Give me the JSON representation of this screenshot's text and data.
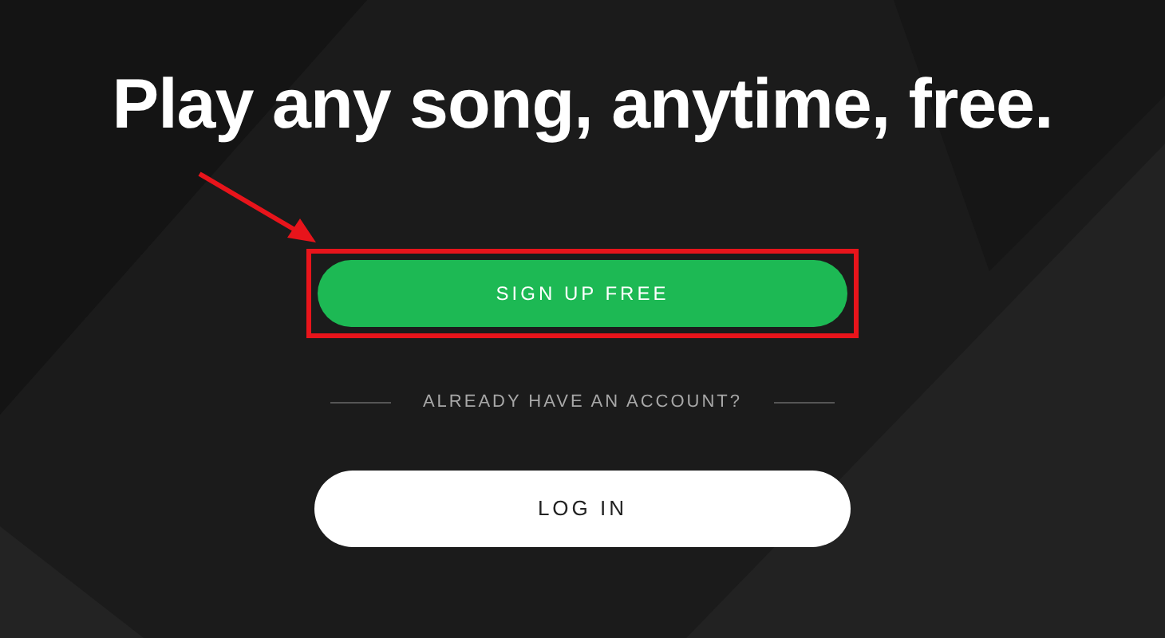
{
  "heading": "Play any song, anytime, free.",
  "signup_button": {
    "label": "SIGN UP FREE"
  },
  "divider_text": "ALREADY HAVE AN ACCOUNT?",
  "login_button": {
    "label": "LOG IN"
  }
}
